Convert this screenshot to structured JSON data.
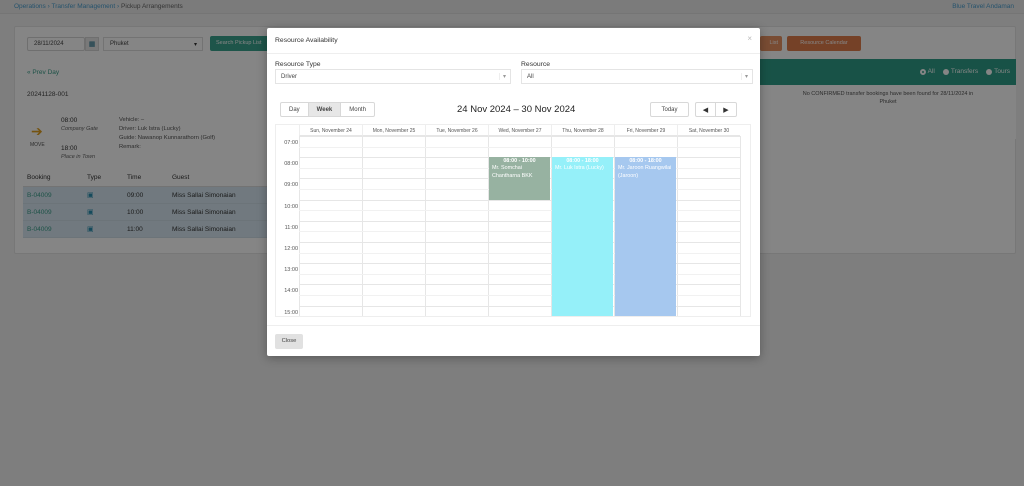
{
  "topbar": {
    "breadcrumbs": [
      "Operations",
      "Transfer Management",
      "Pickup Arrangements"
    ],
    "separator": "›",
    "brand": "Blue Travel Andaman"
  },
  "filters": {
    "date": "28/11/2024",
    "location": "Phuket",
    "search_label": "Search Pickup List",
    "list_label": "List",
    "resource_calendar_label": "Resource Calendar"
  },
  "detail": {
    "prev_day": "« Prev Day",
    "booking_ref": "20241128-001",
    "move_label": "MOVE",
    "start_time": "08:00",
    "start_sub": "Company Gate",
    "end_time": "18:00",
    "end_sub": "Place in Town",
    "vehicle": "Vehicle: –",
    "driver": "Driver: Luk Istra (Lucky)",
    "guide": "Guide: Nawanop Kunnarathorn (Golf)",
    "remark": "Remark:"
  },
  "bookings": {
    "headers": [
      "Booking",
      "Type",
      "Time",
      "Guest"
    ],
    "rows": [
      {
        "booking": "B-04009",
        "type": "bus",
        "time": "09:00",
        "guest": "Miss Sallai Simonaian"
      },
      {
        "booking": "B-04009",
        "type": "bus",
        "time": "10:00",
        "guest": "Miss Sallai Simonaian"
      },
      {
        "booking": "B-04009",
        "type": "bus",
        "time": "11:00",
        "guest": "Miss Sallai Simonaian"
      }
    ]
  },
  "right_panel": {
    "radios": [
      {
        "label": "All",
        "checked": true
      },
      {
        "label": "Transfers",
        "checked": false
      },
      {
        "label": "Tours",
        "checked": false
      }
    ],
    "message": "No CONFIRMED transfer bookings have been found for 28/11/2024 in Phuket"
  },
  "modal": {
    "title": "Resource Availability",
    "close_x": "×",
    "resource_type_label": "Resource Type",
    "resource_type_value": "Driver",
    "resource_label": "Resource",
    "resource_value": "All",
    "views": [
      "Day",
      "Week",
      "Month"
    ],
    "active_view": "Week",
    "date_range": "24 Nov 2024 – 30 Nov 2024",
    "today_label": "Today",
    "prev_icon": "◀",
    "next_icon": "▶",
    "close_label": "Close"
  },
  "calendar": {
    "days": [
      "Sun, November 24",
      "Mon, November 25",
      "Tue, November 26",
      "Wed, November 27",
      "Thu, November 28",
      "Fri, November 29",
      "Sat, November 30"
    ],
    "hours": [
      "07:00",
      "08:00",
      "09:00",
      "10:00",
      "11:00",
      "12:00",
      "13:00",
      "14:00",
      "15:00"
    ],
    "events": [
      {
        "day": 3,
        "start": 8,
        "end": 10,
        "time": "08:00 - 10:00",
        "name": "Mr. Somchai Chantharna BKK",
        "color": "#97b2a1"
      },
      {
        "day": 4,
        "start": 8,
        "end": 18,
        "time": "08:00 - 18:00",
        "name": "Mr. Luk Istra (Lucky)",
        "color": "#95f0f9"
      },
      {
        "day": 5,
        "start": 8,
        "end": 18,
        "time": "08:00 - 18:00",
        "name": "Mr. Jaroon Ruangwilai (Jaroon)",
        "color": "#a6c8ef"
      }
    ]
  }
}
